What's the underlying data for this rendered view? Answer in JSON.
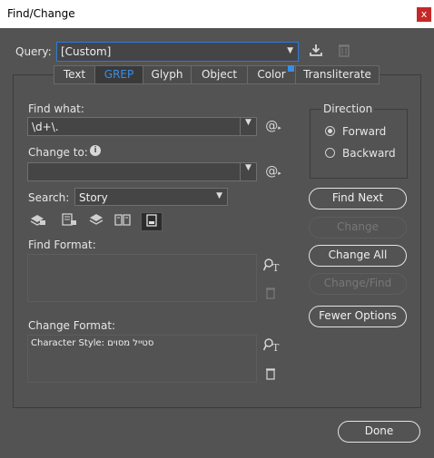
{
  "window": {
    "title": "Find/Change",
    "close_label": "x"
  },
  "query": {
    "label": "Query:",
    "value": "[Custom]"
  },
  "tabs": [
    {
      "label": "Text"
    },
    {
      "label": "GREP"
    },
    {
      "label": "Glyph"
    },
    {
      "label": "Object"
    },
    {
      "label": "Color"
    },
    {
      "label": "Transliterate"
    }
  ],
  "selected_tab": "GREP",
  "accent_color": "#2e79d8",
  "find_what": {
    "label": "Find what:",
    "value": "\\d+\\."
  },
  "change_to": {
    "label": "Change to:",
    "value": ""
  },
  "search": {
    "label": "Search:",
    "value": "Story"
  },
  "find_format": {
    "label": "Find Format:",
    "value": ""
  },
  "change_format": {
    "label": "Change Format:",
    "value": "Character Style: סטייל מסוים"
  },
  "direction": {
    "label": "Direction",
    "options": [
      {
        "label": "Forward",
        "selected": true
      },
      {
        "label": "Backward",
        "selected": false
      }
    ]
  },
  "buttons": {
    "find_next": "Find Next",
    "change": "Change",
    "change_all": "Change All",
    "change_find": "Change/Find",
    "fewer_options": "Fewer Options",
    "done": "Done"
  },
  "icons": {
    "save_query": "download-icon",
    "delete_query": "trash-icon",
    "special_chars": "at-sign-menu-icon",
    "info": "info-icon"
  }
}
